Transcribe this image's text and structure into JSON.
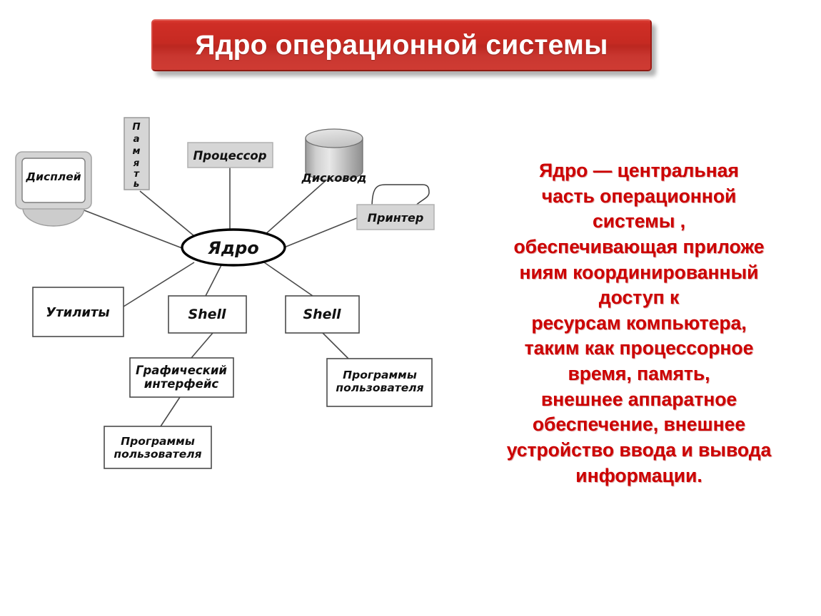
{
  "slide": {
    "title": "Ядро операционной системы",
    "title_bg_color": "#c62a22",
    "title_text_color": "#ffffff",
    "body_text_color": "#cc0000"
  },
  "body": {
    "lines": [
      "Ядро — центральная",
      "часть операционной",
      "системы ,",
      "обеспечивающая приложе",
      "ниям координированный",
      "доступ к",
      "ресурсам компьютера,",
      "таким как процессорное",
      "время, память,",
      "внешнее аппаратное",
      "обеспечение, внешнее",
      "устройство ввода и вывода",
      "информации."
    ]
  },
  "diagram": {
    "center": {
      "label": "Ядро",
      "shape": "ellipse"
    },
    "nodes": [
      {
        "id": "display",
        "label": "Дисплей",
        "shape": "monitor"
      },
      {
        "id": "memory",
        "label": "Память",
        "shape": "vertical-box"
      },
      {
        "id": "cpu",
        "label": "Процессор",
        "shape": "gray-box"
      },
      {
        "id": "disk",
        "label": "Дисковод",
        "shape": "cylinder"
      },
      {
        "id": "printer",
        "label": "Принтер",
        "shape": "printer"
      },
      {
        "id": "utils",
        "label": "Утилиты",
        "shape": "box"
      },
      {
        "id": "shell1",
        "label": "Shell",
        "shape": "box"
      },
      {
        "id": "shell2",
        "label": "Shell",
        "shape": "box"
      },
      {
        "id": "gui",
        "label": "Графический\nинтерфейс",
        "shape": "box",
        "label_line1": "Графический",
        "label_line2": "интерфейс"
      },
      {
        "id": "userprog1",
        "label": "Программы\nпользователя",
        "shape": "box",
        "label_line1": "Программы",
        "label_line2": "пользователя"
      },
      {
        "id": "userprog2",
        "label": "Программы\nпользователя",
        "shape": "box",
        "label_line1": "Программы",
        "label_line2": "пользователя"
      }
    ],
    "memory_letters": [
      "П",
      "а",
      "м",
      "я",
      "т",
      "ь"
    ],
    "edges": [
      {
        "from": "kernel",
        "to": "display"
      },
      {
        "from": "kernel",
        "to": "memory"
      },
      {
        "from": "kernel",
        "to": "cpu"
      },
      {
        "from": "kernel",
        "to": "disk"
      },
      {
        "from": "kernel",
        "to": "printer"
      },
      {
        "from": "kernel",
        "to": "utils"
      },
      {
        "from": "kernel",
        "to": "shell1"
      },
      {
        "from": "kernel",
        "to": "shell2"
      },
      {
        "from": "shell1",
        "to": "gui"
      },
      {
        "from": "gui",
        "to": "userprog1"
      },
      {
        "from": "shell2",
        "to": "userprog2"
      }
    ]
  }
}
